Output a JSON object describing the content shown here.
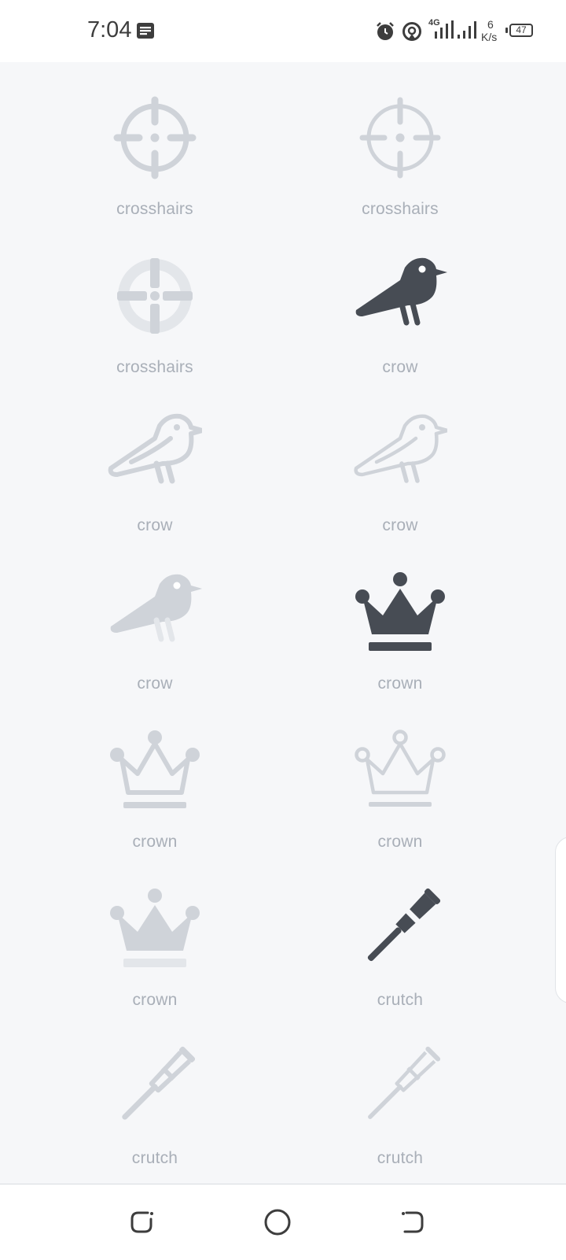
{
  "status": {
    "time": "7:04",
    "network_speed_value": "6",
    "network_speed_unit": "K/s",
    "battery": "47",
    "network_type": "4G"
  },
  "icons": [
    {
      "label": "crosshairs",
      "style": "light",
      "glyph": "crosshairs"
    },
    {
      "label": "crosshairs",
      "style": "thin",
      "glyph": "crosshairs"
    },
    {
      "label": "crosshairs",
      "style": "duotone",
      "glyph": "crosshairs"
    },
    {
      "label": "crow",
      "style": "solid",
      "glyph": "crow"
    },
    {
      "label": "crow",
      "style": "regular",
      "glyph": "crow"
    },
    {
      "label": "crow",
      "style": "light",
      "glyph": "crow"
    },
    {
      "label": "crow",
      "style": "duotone",
      "glyph": "crow"
    },
    {
      "label": "crown",
      "style": "solid",
      "glyph": "crown"
    },
    {
      "label": "crown",
      "style": "regular",
      "glyph": "crown"
    },
    {
      "label": "crown",
      "style": "light",
      "glyph": "crown"
    },
    {
      "label": "crown",
      "style": "duotone",
      "glyph": "crown"
    },
    {
      "label": "crutch",
      "style": "solid",
      "glyph": "crutch"
    },
    {
      "label": "crutch",
      "style": "regular",
      "glyph": "crutch"
    },
    {
      "label": "crutch",
      "style": "light",
      "glyph": "crutch"
    }
  ],
  "colors": {
    "solid": "#474c54",
    "muted": "#cfd3d9",
    "muted_light": "#e3e6ea",
    "label": "#a9afb8",
    "background": "#f6f7f9"
  }
}
